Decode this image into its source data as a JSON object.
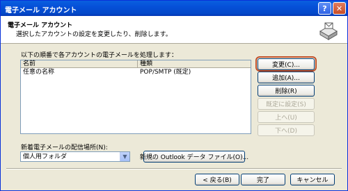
{
  "window": {
    "title": "電子メール アカウント",
    "help_label": "?",
    "close_label": "✕"
  },
  "header": {
    "title": "電子メール アカウント",
    "subtitle": "選択したアカウントの設定を変更したり、削除します。",
    "icon": "mail-accounts-icon"
  },
  "list": {
    "caption": "以下の順番で各アカウントの電子メールを処理します：",
    "columns": [
      "名前",
      "種類"
    ],
    "rows": [
      {
        "name": "任意の名称",
        "type": "POP/SMTP (既定)"
      }
    ]
  },
  "side_buttons": {
    "change": "変更(C)...",
    "add": "追加(A)...",
    "remove": "削除(R)",
    "set_default": "既定に設定(S)",
    "up": "上へ(U)",
    "down": "下へ(D)"
  },
  "delivery": {
    "label": "新着電子メールの配信場所(N):",
    "selected": "個人用フォルダ",
    "new_data_file": "新規の Outlook データ ファイル(O)..."
  },
  "footer": {
    "back": "< 戻る(B)",
    "finish": "完了",
    "cancel": "キャンセル"
  },
  "colors": {
    "accent_highlight": "#c0502a",
    "titlebar": "#0550d8"
  }
}
